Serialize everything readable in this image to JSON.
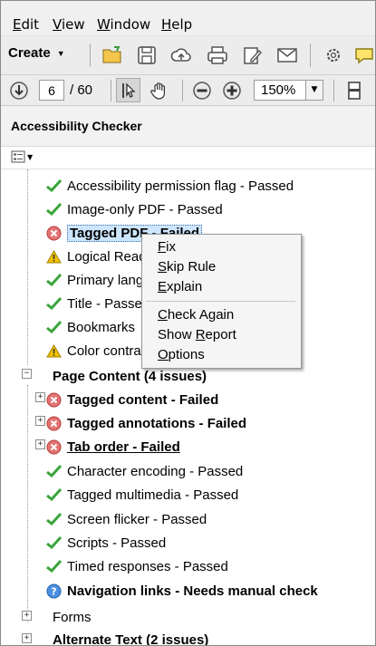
{
  "menu": [
    {
      "label": "Edit",
      "accel": "E",
      "rest": "dit"
    },
    {
      "label": "View",
      "accel": "V",
      "rest": "iew"
    },
    {
      "label": "Window",
      "accel": "W",
      "rest": "indow"
    },
    {
      "label": "Help",
      "accel": "H",
      "rest": "elp"
    }
  ],
  "toolbar": {
    "create_label": "Create",
    "page_current": "6",
    "page_total": "/ 60",
    "zoom": "150%"
  },
  "panel": {
    "title": "Accessibility Checker"
  },
  "tree": {
    "items": [
      {
        "text": "Accessibility permission flag - Passed",
        "status": "passed"
      },
      {
        "text": "Image-only PDF - Passed",
        "status": "passed"
      },
      {
        "text": "Tagged PDF - Failed",
        "status": "failed"
      },
      {
        "text": "Logical Reading Order",
        "status": "warning"
      },
      {
        "text": "Primary language",
        "status": "passed"
      },
      {
        "text": "Title - Passed",
        "status": "passed"
      },
      {
        "text": "Bookmarks",
        "status": "passed"
      },
      {
        "text": "Color contrast",
        "status": "warning"
      },
      {
        "text": "Page Content (4 issues)",
        "status": "group"
      },
      {
        "text": "Tagged content - Failed",
        "status": "failed"
      },
      {
        "text": "Tagged annotations - Failed",
        "status": "failed"
      },
      {
        "text": "Tab order - Failed",
        "status": "failed"
      },
      {
        "text": "Character encoding - Passed",
        "status": "passed"
      },
      {
        "text": "Tagged multimedia - Passed",
        "status": "passed"
      },
      {
        "text": "Screen flicker - Passed",
        "status": "passed"
      },
      {
        "text": "Scripts - Passed",
        "status": "passed"
      },
      {
        "text": "Timed responses - Passed",
        "status": "passed"
      },
      {
        "text": "Navigation links - Needs manual check",
        "status": "manual"
      },
      {
        "text": "Forms",
        "status": "group"
      },
      {
        "text": "Alternate Text (2 issues)",
        "status": "group"
      }
    ]
  },
  "context_menu": {
    "items": [
      {
        "accel": "F",
        "rest": "ix"
      },
      {
        "accel": "S",
        "rest": "kip Rule"
      },
      {
        "accel": "E",
        "rest": "xplain"
      },
      {
        "accel": "C",
        "rest": "heck Again"
      },
      {
        "pre": "Show ",
        "accel": "R",
        "rest": "eport"
      },
      {
        "accel": "O",
        "rest": "ptions"
      }
    ]
  },
  "colors": {
    "passed": "#3aa53a",
    "failed": "#d9534f",
    "warning": "#f2c200",
    "manual": "#2d7bd6",
    "selection": "#cde6ff"
  }
}
